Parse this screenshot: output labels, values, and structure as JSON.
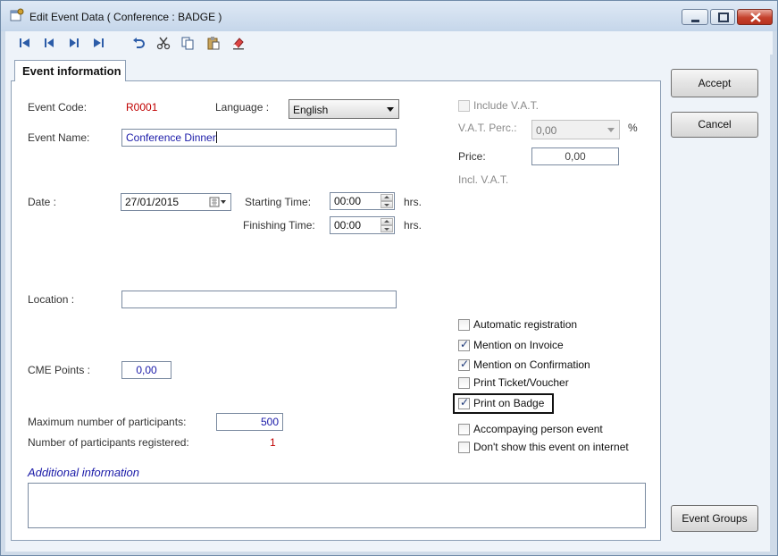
{
  "window": {
    "title": "Edit Event Data  ( Conference : BADGE )"
  },
  "toolbar": {
    "icons": [
      "first-record-icon",
      "previous-record-icon",
      "next-record-icon",
      "last-record-icon",
      "undo-icon",
      "cut-icon",
      "copy-icon",
      "paste-icon",
      "clear-icon"
    ]
  },
  "tab": {
    "label": "Event information"
  },
  "form": {
    "event_code_label": "Event Code:",
    "event_code_value": "R0001",
    "language_label": "Language :",
    "language_value": "English",
    "event_name_label": "Event Name:",
    "event_name_value": "Conference Dinner",
    "date_label": "Date :",
    "date_value": "27/01/2015",
    "starting_time_label": "Starting Time:",
    "starting_time_value": "00:00",
    "finishing_time_label": "Finishing Time:",
    "finishing_time_value": "00:00",
    "hrs_label": "hrs.",
    "location_label": "Location :",
    "location_value": "",
    "cme_label": "CME Points :",
    "cme_value": "0,00",
    "max_participants_label": "Maximum number of participants:",
    "max_participants_value": "500",
    "registered_label": "Number of participants registered:",
    "registered_value": "1",
    "additional_info_label": "Additional information",
    "additional_info_value": ""
  },
  "vat": {
    "include_label": "Include V.A.T.",
    "include_checked": false,
    "perc_label": "V.A.T. Perc.:",
    "perc_value": "0,00",
    "percent_sign": "%",
    "price_label": "Price:",
    "price_value": "0,00",
    "incl_label": "Incl. V.A.T."
  },
  "options": [
    {
      "label": "Automatic registration",
      "checked": false
    },
    {
      "label": "Mention on Invoice",
      "checked": true
    },
    {
      "label": "Mention on Confirmation",
      "checked": true
    },
    {
      "label": "Print Ticket/Voucher",
      "checked": false
    },
    {
      "label": "Print on Badge",
      "checked": true
    },
    {
      "label": "Accompaying person event",
      "checked": false
    },
    {
      "label": "Don't show this event on internet",
      "checked": false
    }
  ],
  "buttons": {
    "accept": "Accept",
    "cancel": "Cancel",
    "event_groups": "Event Groups"
  }
}
